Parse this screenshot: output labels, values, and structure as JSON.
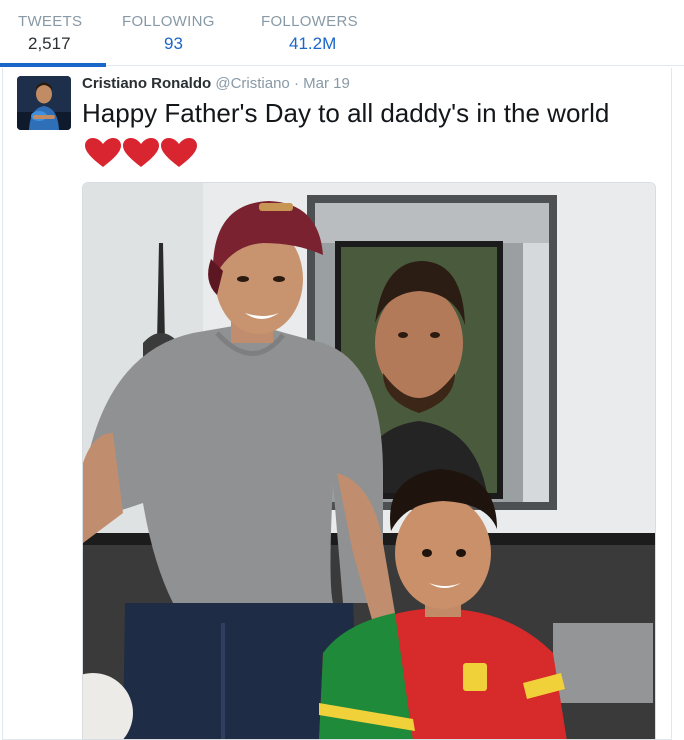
{
  "stats": {
    "tweets": {
      "label": "TWEETS",
      "value": "2,517"
    },
    "following": {
      "label": "FOLLOWING",
      "value": "93"
    },
    "followers": {
      "label": "FOLLOWERS",
      "value": "41.2M"
    }
  },
  "tweet": {
    "fullname": "Cristiano Ronaldo",
    "username": "@Cristiano",
    "separator": "·",
    "timestamp": "Mar 19",
    "text": "Happy Father's Day to all daddy's in the world",
    "emoji": [
      "red-heart",
      "red-heart",
      "red-heart"
    ]
  },
  "colors": {
    "link_blue": "#1b66c9",
    "muted_gray": "#8899a6",
    "heart_red": "#d9252f"
  }
}
